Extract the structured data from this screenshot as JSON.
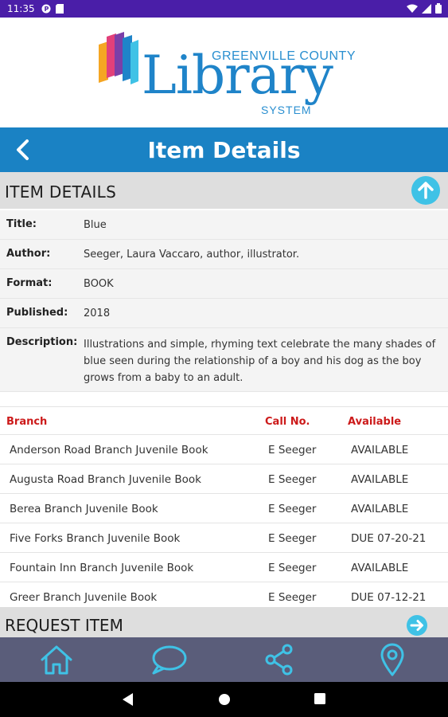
{
  "status_bar": {
    "time": "11:35"
  },
  "logo": {
    "county": "GREENVILLE COUNTY",
    "library": "Library",
    "system": "SYSTEM"
  },
  "header": {
    "title": "Item Details"
  },
  "item_details": {
    "section_label": "ITEM DETAILS",
    "rows": [
      {
        "key": "Title:",
        "value": "Blue"
      },
      {
        "key": "Author:",
        "value": "Seeger, Laura Vaccaro, author, illustrator."
      },
      {
        "key": "Format:",
        "value": "BOOK"
      },
      {
        "key": "Published:",
        "value": "2018"
      },
      {
        "key": "Description:",
        "value": "Illustrations and simple, rhyming text celebrate the many shades of blue seen during the relationship of a boy and his dog as the boy grows from a baby to an adult."
      }
    ]
  },
  "branches": {
    "columns": [
      "Branch",
      "Call No.",
      "Available"
    ],
    "rows": [
      {
        "branch": "Anderson Road Branch Juvenile Book",
        "call_no": "E Seeger",
        "available": "AVAILABLE"
      },
      {
        "branch": "Augusta Road Branch Juvenile Book",
        "call_no": "E Seeger",
        "available": "AVAILABLE"
      },
      {
        "branch": "Berea Branch Juvenile Book",
        "call_no": "E Seeger",
        "available": "AVAILABLE"
      },
      {
        "branch": "Five Forks Branch Juvenile Book",
        "call_no": "E Seeger",
        "available": "DUE 07-20-21"
      },
      {
        "branch": "Fountain Inn Branch Juvenile Book",
        "call_no": "E Seeger",
        "available": "AVAILABLE"
      },
      {
        "branch": "Greer Branch Juvenile Book",
        "call_no": "E Seeger",
        "available": "DUE 07-12-21"
      }
    ]
  },
  "request_item": {
    "label": "REQUEST ITEM"
  },
  "bottom_nav": {
    "items": [
      {
        "icon": "home-icon"
      },
      {
        "icon": "chat-icon"
      },
      {
        "icon": "share-icon"
      },
      {
        "icon": "location-pin-icon"
      }
    ]
  },
  "colors": {
    "status_bar": "#4a1ea8",
    "title_bar": "#1a82c4",
    "accent_cyan": "#3fc2e6",
    "table_header_red": "#cc1a1a",
    "bottom_nav": "#5a5d7a"
  }
}
